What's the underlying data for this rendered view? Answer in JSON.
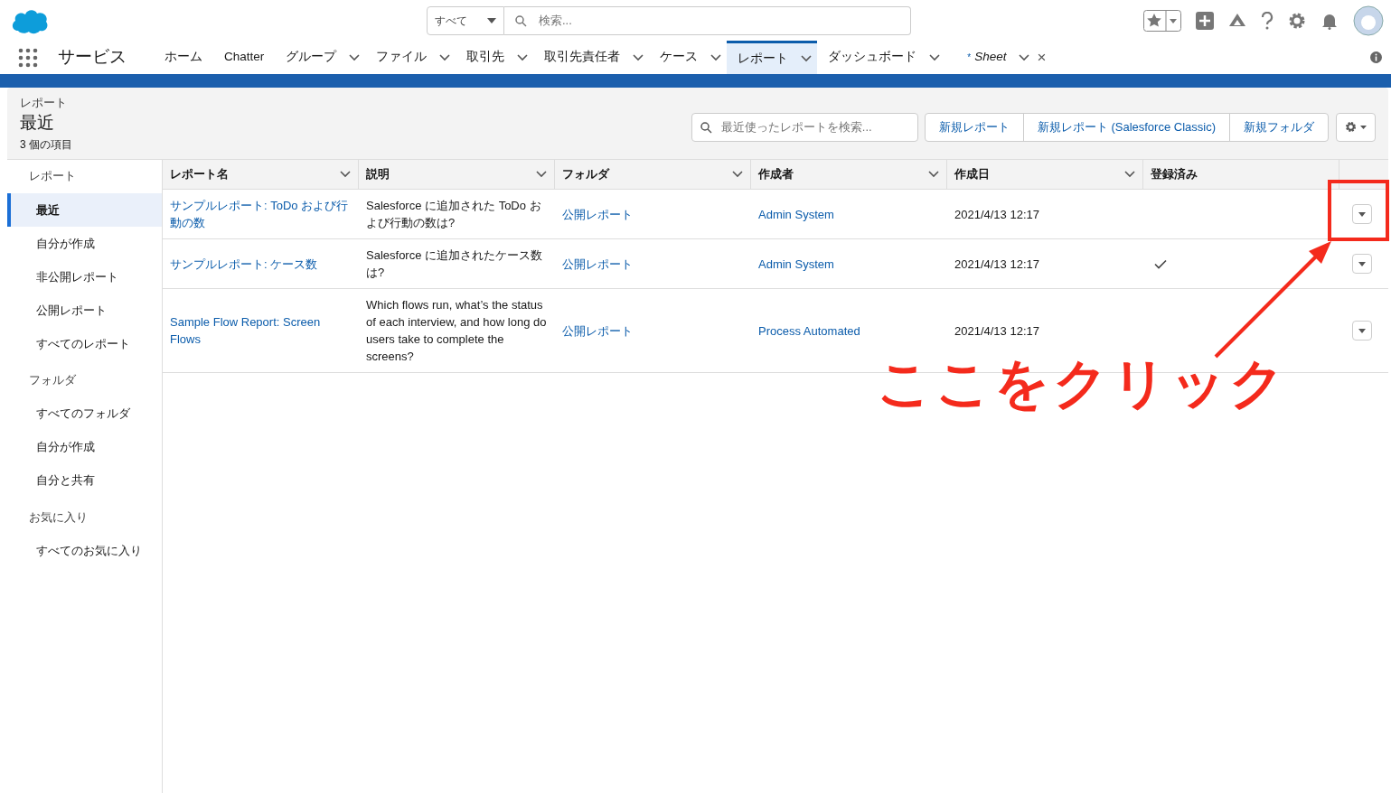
{
  "header": {
    "search_scope": "すべて",
    "search_placeholder": "検索..."
  },
  "nav": {
    "app_name": "サービス",
    "tabs": [
      {
        "label": "ホーム",
        "has_menu": false,
        "selected": false,
        "kind": "object"
      },
      {
        "label": "Chatter",
        "has_menu": false,
        "selected": false,
        "kind": "object"
      },
      {
        "label": "グループ",
        "has_menu": true,
        "selected": false,
        "kind": "object"
      },
      {
        "label": "ファイル",
        "has_menu": true,
        "selected": false,
        "kind": "object"
      },
      {
        "label": "取引先",
        "has_menu": true,
        "selected": false,
        "kind": "object"
      },
      {
        "label": "取引先責任者",
        "has_menu": true,
        "selected": false,
        "kind": "object"
      },
      {
        "label": "ケース",
        "has_menu": true,
        "selected": false,
        "kind": "object"
      },
      {
        "label": "レポート",
        "has_menu": true,
        "selected": true,
        "kind": "object"
      },
      {
        "label": "ダッシュボード",
        "has_menu": true,
        "selected": false,
        "kind": "object"
      },
      {
        "label": "Sheet",
        "has_menu": true,
        "selected": false,
        "kind": "record",
        "marker": "*",
        "close": "×"
      }
    ]
  },
  "page": {
    "breadcrumb": "レポート",
    "title": "最近",
    "count": "3 個の項目",
    "search_placeholder": "最近使ったレポートを検索...",
    "buttons": [
      "新規レポート",
      "新規レポート (Salesforce Classic)",
      "新規フォルダ"
    ]
  },
  "sidebar": {
    "sections": [
      {
        "heading": "レポート",
        "items": [
          {
            "label": "最近",
            "selected": true
          },
          {
            "label": "自分が作成",
            "selected": false
          },
          {
            "label": "非公開レポート",
            "selected": false
          },
          {
            "label": "公開レポート",
            "selected": false
          },
          {
            "label": "すべてのレポート",
            "selected": false
          }
        ]
      },
      {
        "heading": "フォルダ",
        "items": [
          {
            "label": "すべてのフォルダ",
            "selected": false
          },
          {
            "label": "自分が作成",
            "selected": false
          },
          {
            "label": "自分と共有",
            "selected": false
          }
        ]
      },
      {
        "heading": "お気に入り",
        "items": [
          {
            "label": "すべてのお気に入り",
            "selected": false
          }
        ]
      }
    ]
  },
  "table": {
    "columns": [
      {
        "label": "レポート名",
        "sortable": true
      },
      {
        "label": "説明",
        "sortable": true
      },
      {
        "label": "フォルダ",
        "sortable": true
      },
      {
        "label": "作成者",
        "sortable": true
      },
      {
        "label": "作成日",
        "sortable": true
      },
      {
        "label": "登録済み",
        "sortable": false
      }
    ],
    "rows": [
      {
        "name": "サンプルレポート: ToDo および行動の数",
        "description": "Salesforce に追加された ToDo および行動の数は?",
        "folder": "公開レポート",
        "created_by": "Admin System",
        "created_date": "2021/4/13 12:17",
        "subscribed": false
      },
      {
        "name": "サンプルレポート: ケース数",
        "description": "Salesforce に追加されたケース数は?",
        "folder": "公開レポート",
        "created_by": "Admin System",
        "created_date": "2021/4/13 12:17",
        "subscribed": true
      },
      {
        "name": "Sample Flow Report: Screen Flows",
        "description": "Which flows run, what’s the status of each interview, and how long do users take to complete the screens?",
        "folder": "公開レポート",
        "created_by": "Process Automated",
        "created_date": "2021/4/13 12:17",
        "subscribed": false
      }
    ]
  },
  "annotation": {
    "text": "ここをクリック"
  }
}
